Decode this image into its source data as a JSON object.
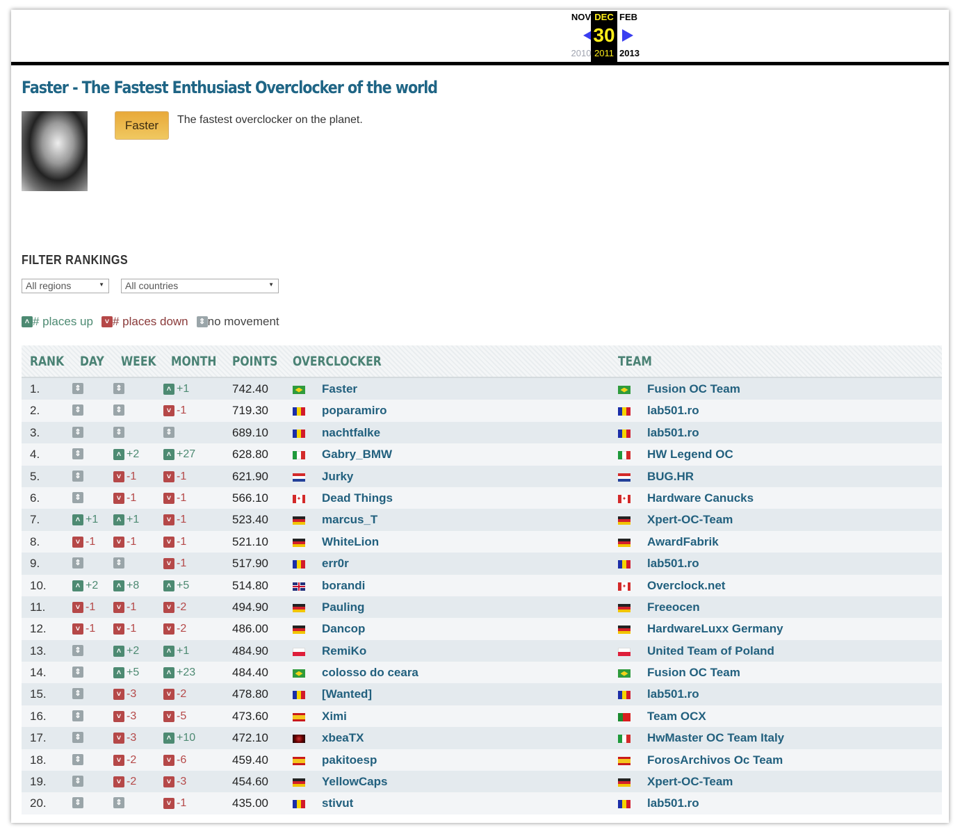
{
  "calendar": {
    "prev": {
      "month": "NOV",
      "year": "2010"
    },
    "current": {
      "month": "DEC",
      "day": "30",
      "year": "2011"
    },
    "next": {
      "month": "FEB",
      "year": "2013"
    }
  },
  "title": "Faster - The Fastest Enthusiast Overclocker of the world",
  "profile": {
    "badge": "Faster",
    "description": "The fastest overclocker on the planet."
  },
  "filter": {
    "heading": "FILTER RANKINGS",
    "region": "All regions",
    "country": "All countries"
  },
  "legend": {
    "up": "# places up",
    "down": "# places down",
    "same": "no movement"
  },
  "columns": [
    "RANK",
    "DAY",
    "WEEK",
    "MONTH",
    "POINTS",
    "OVERCLOCKER",
    "TEAM"
  ],
  "colors": {
    "up": "#4d8a72",
    "down": "#b54848",
    "same": "#9aa5a9"
  },
  "rows": [
    {
      "rank": "1.",
      "day": "",
      "week": "",
      "month": "+1",
      "points": "742.40",
      "flag": "br",
      "name": "Faster",
      "team_flag": "br",
      "team": "Fusion OC Team"
    },
    {
      "rank": "2.",
      "day": "",
      "week": "",
      "month": "-1",
      "points": "719.30",
      "flag": "ro",
      "name": "poparamiro",
      "team_flag": "ro",
      "team": "lab501.ro"
    },
    {
      "rank": "3.",
      "day": "",
      "week": "",
      "month": "",
      "points": "689.10",
      "flag": "ro",
      "name": "nachtfalke",
      "team_flag": "ro",
      "team": "lab501.ro"
    },
    {
      "rank": "4.",
      "day": "",
      "week": "+2",
      "month": "+27",
      "points": "628.80",
      "flag": "it",
      "name": "Gabry_BMW",
      "team_flag": "it",
      "team": "HW Legend OC"
    },
    {
      "rank": "5.",
      "day": "",
      "week": "-1",
      "month": "-1",
      "points": "621.90",
      "flag": "hr",
      "name": "Jurky",
      "team_flag": "hr",
      "team": "BUG.HR"
    },
    {
      "rank": "6.",
      "day": "",
      "week": "-1",
      "month": "-1",
      "points": "566.10",
      "flag": "ca",
      "name": "Dead Things",
      "team_flag": "ca",
      "team": "Hardware Canucks"
    },
    {
      "rank": "7.",
      "day": "+1",
      "week": "+1",
      "month": "-1",
      "points": "523.40",
      "flag": "de",
      "name": "marcus_T",
      "team_flag": "de",
      "team": "Xpert-OC-Team"
    },
    {
      "rank": "8.",
      "day": "-1",
      "week": "-1",
      "month": "-1",
      "points": "521.10",
      "flag": "de",
      "name": "WhiteLion",
      "team_flag": "de",
      "team": "AwardFabrik"
    },
    {
      "rank": "9.",
      "day": "",
      "week": "",
      "month": "-1",
      "points": "517.90",
      "flag": "ro",
      "name": "err0r",
      "team_flag": "ro",
      "team": "lab501.ro"
    },
    {
      "rank": "10.",
      "day": "+2",
      "week": "+8",
      "month": "+5",
      "points": "514.80",
      "flag": "gb",
      "name": "borandi",
      "team_flag": "ca",
      "team": "Overclock.net"
    },
    {
      "rank": "11.",
      "day": "-1",
      "week": "-1",
      "month": "-2",
      "points": "494.90",
      "flag": "de",
      "name": "Pauling",
      "team_flag": "de",
      "team": "Freeocen"
    },
    {
      "rank": "12.",
      "day": "-1",
      "week": "-1",
      "month": "-2",
      "points": "486.00",
      "flag": "de",
      "name": "Dancop",
      "team_flag": "de",
      "team": "HardwareLuxx Germany"
    },
    {
      "rank": "13.",
      "day": "",
      "week": "+2",
      "month": "+1",
      "points": "484.90",
      "flag": "pl",
      "name": "RemiKo",
      "team_flag": "pl",
      "team": "United Team of Poland"
    },
    {
      "rank": "14.",
      "day": "",
      "week": "+5",
      "month": "+23",
      "points": "484.40",
      "flag": "br",
      "name": "colosso do ceara",
      "team_flag": "br",
      "team": "Fusion OC Team"
    },
    {
      "rank": "15.",
      "day": "",
      "week": "-3",
      "month": "-2",
      "points": "478.80",
      "flag": "ro",
      "name": "[Wanted]",
      "team_flag": "ro",
      "team": "lab501.ro"
    },
    {
      "rank": "16.",
      "day": "",
      "week": "-3",
      "month": "-5",
      "points": "473.60",
      "flag": "es",
      "name": "Ximi",
      "team_flag": "pt",
      "team": "Team OCX"
    },
    {
      "rank": "17.",
      "day": "",
      "week": "-3",
      "month": "+10",
      "points": "472.10",
      "flag": "xx",
      "name": "xbeaTX",
      "team_flag": "it",
      "team": "HwMaster OC Team Italy"
    },
    {
      "rank": "18.",
      "day": "",
      "week": "-2",
      "month": "-6",
      "points": "459.40",
      "flag": "es",
      "name": "pakitoesp",
      "team_flag": "es",
      "team": "ForosArchivos Oc Team"
    },
    {
      "rank": "19.",
      "day": "",
      "week": "-2",
      "month": "-3",
      "points": "454.60",
      "flag": "de",
      "name": "YellowCaps",
      "team_flag": "de",
      "team": "Xpert-OC-Team"
    },
    {
      "rank": "20.",
      "day": "",
      "week": "",
      "month": "-1",
      "points": "435.00",
      "flag": "ro",
      "name": "stivut",
      "team_flag": "ro",
      "team": "lab501.ro"
    }
  ]
}
